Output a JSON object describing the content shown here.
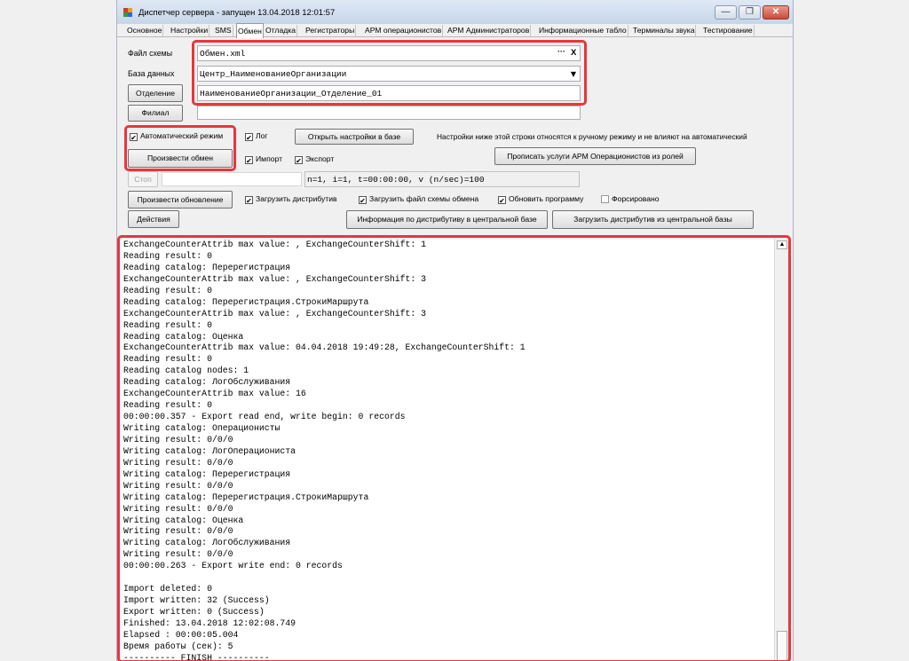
{
  "window": {
    "title": "Диспетчер сервера - запущен 13.04.2018 12:01:57",
    "minimize": "—",
    "restore": "❐",
    "close": "✕"
  },
  "tabs": [
    "Основное",
    "Настройки",
    "SMS",
    "Обмен",
    "Отладка",
    "Регистраторы",
    "АРМ операционистов",
    "АРМ Администраторов",
    "Информационные табло",
    "Терминалы звука",
    "Тестирование"
  ],
  "active_tab": "Обмен",
  "form": {
    "schema_label": "Файл схемы",
    "schema_value": "Обмен.xml",
    "schema_browse": "···",
    "schema_clear": "X",
    "db_label": "База данных",
    "db_value": "Центр_НаименованиеОрганизации",
    "department_button": "Отделение",
    "department_value": "НаименованиеОрганизации_Отделение_01",
    "branch_button": "Филиал",
    "branch_value": ""
  },
  "controls": {
    "auto_mode": "Автоматический режим",
    "log": "Лог",
    "open_settings": "Открыть настройки в базе",
    "manual_note": "Настройки ниже этой строки относятся к ручному режиму и не влияют на автоматический",
    "run_exchange": "Произвести обмен",
    "import": "Импорт",
    "export": "Экспорт",
    "assign_services": "Прописать услуги АРМ Операционистов из ролей",
    "stop": "Стоп",
    "stats": "n=1, i=1, t=00:00:00, v (n/sec)=100",
    "run_update": "Произвести обновление",
    "load_distrib": "Загрузить дистрибутив",
    "load_schema": "Загрузить файл схемы обмена",
    "update_program": "Обновить программу",
    "force": "Форсировано",
    "actions": "Действия",
    "distrib_info": "Информация по дистрибутиву в центральной базе",
    "load_distrib_central": "Загрузить дистрибутив из центральной базы"
  },
  "log_lines": [
    "ExchangeCounterAttrib max value: , ExchangeCounterShift: 1",
    "Reading result: 0",
    "Reading catalog: Перерегистрация",
    "ExchangeCounterAttrib max value: , ExchangeCounterShift: 3",
    "Reading result: 0",
    "Reading catalog: Перерегистрация.СтрокиМаршрута",
    "ExchangeCounterAttrib max value: , ExchangeCounterShift: 3",
    "Reading result: 0",
    "Reading catalog: Оценка",
    "ExchangeCounterAttrib max value: 04.04.2018 19:49:28, ExchangeCounterShift: 1",
    "Reading result: 0",
    "Reading catalog nodes: 1",
    "Reading catalog: ЛогОбслуживания",
    "ExchangeCounterAttrib max value: 16",
    "Reading result: 0",
    "00:00:00.357 - Export read end, write begin: 0 records",
    "Writing catalog: Операционисты",
    "Writing result: 0/0/0",
    "Writing catalog: ЛогОперациониста",
    "Writing result: 0/0/0",
    "Writing catalog: Перерегистрация",
    "Writing result: 0/0/0",
    "Writing catalog: Перерегистрация.СтрокиМаршрута",
    "Writing result: 0/0/0",
    "Writing catalog: Оценка",
    "Writing result: 0/0/0",
    "Writing catalog: ЛогОбслуживания",
    "Writing result: 0/0/0",
    "00:00:00.263 - Export write end: 0 records",
    "",
    "Import deleted: 0",
    "Import written: 32 (Success)",
    "Export written: 0 (Success)",
    "Finished: 13.04.2018 12:02:08.749",
    "Elapsed : 00:00:05.004",
    "Время работы (сек): 5",
    "---------- FINISH ----------"
  ],
  "colors": {
    "highlight": "#e8363c",
    "titlebar": "#c6d6ea"
  }
}
